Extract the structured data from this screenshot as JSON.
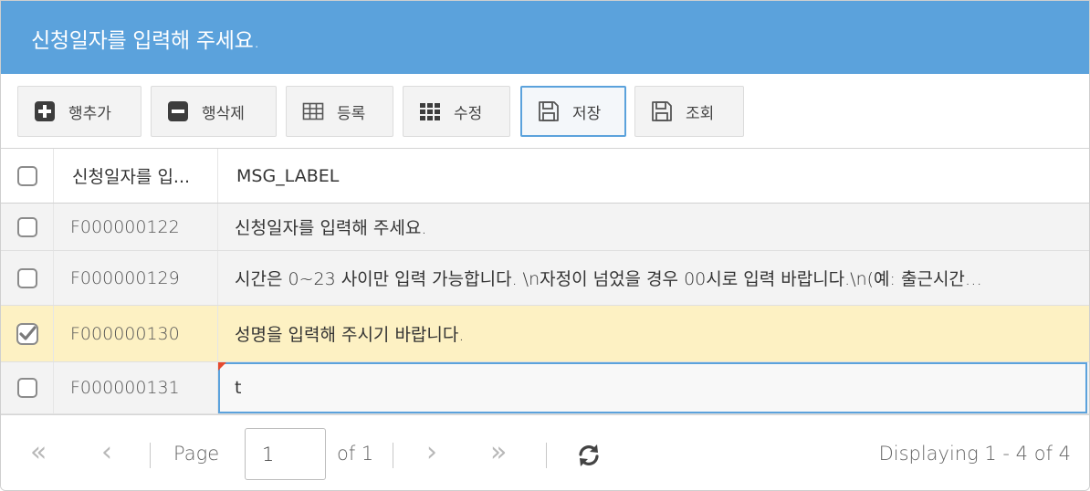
{
  "title": "신청일자를 입력해 주세요.",
  "toolbar": {
    "buttons": [
      {
        "label": "행추가",
        "icon": "plus-square-icon"
      },
      {
        "label": "행삭제",
        "icon": "minus-square-icon"
      },
      {
        "label": "등록",
        "icon": "table-icon"
      },
      {
        "label": "수정",
        "icon": "grid-icon"
      },
      {
        "label": "저장",
        "icon": "save-icon"
      },
      {
        "label": "조회",
        "icon": "save-icon"
      }
    ]
  },
  "grid": {
    "columns": [
      "신청일자를 입...",
      "MSG_LABEL"
    ],
    "rows": [
      {
        "code": "F000000122",
        "msg": "신청일자를 입력해 주세요.",
        "checked": false
      },
      {
        "code": "F000000129",
        "msg": "시간은 0~23 사이만 입력 가능합니다. \\n자정이 넘었을 경우 00시로 입력 바랍니다.\\n(예: 출근시간…",
        "checked": false
      },
      {
        "code": "F000000130",
        "msg": "성명을 입력해 주시기 바랍니다.",
        "checked": true
      },
      {
        "code": "F000000131",
        "msg": "t",
        "checked": false
      }
    ]
  },
  "pager": {
    "page_label": "Page",
    "page_value": "1",
    "of_label": "of 1",
    "info": "Displaying 1 - 4 of 4"
  },
  "colors": {
    "titlebar": "#5ba2dc",
    "selected_row": "#fdf1c3",
    "accent": "#5ba2dc"
  }
}
